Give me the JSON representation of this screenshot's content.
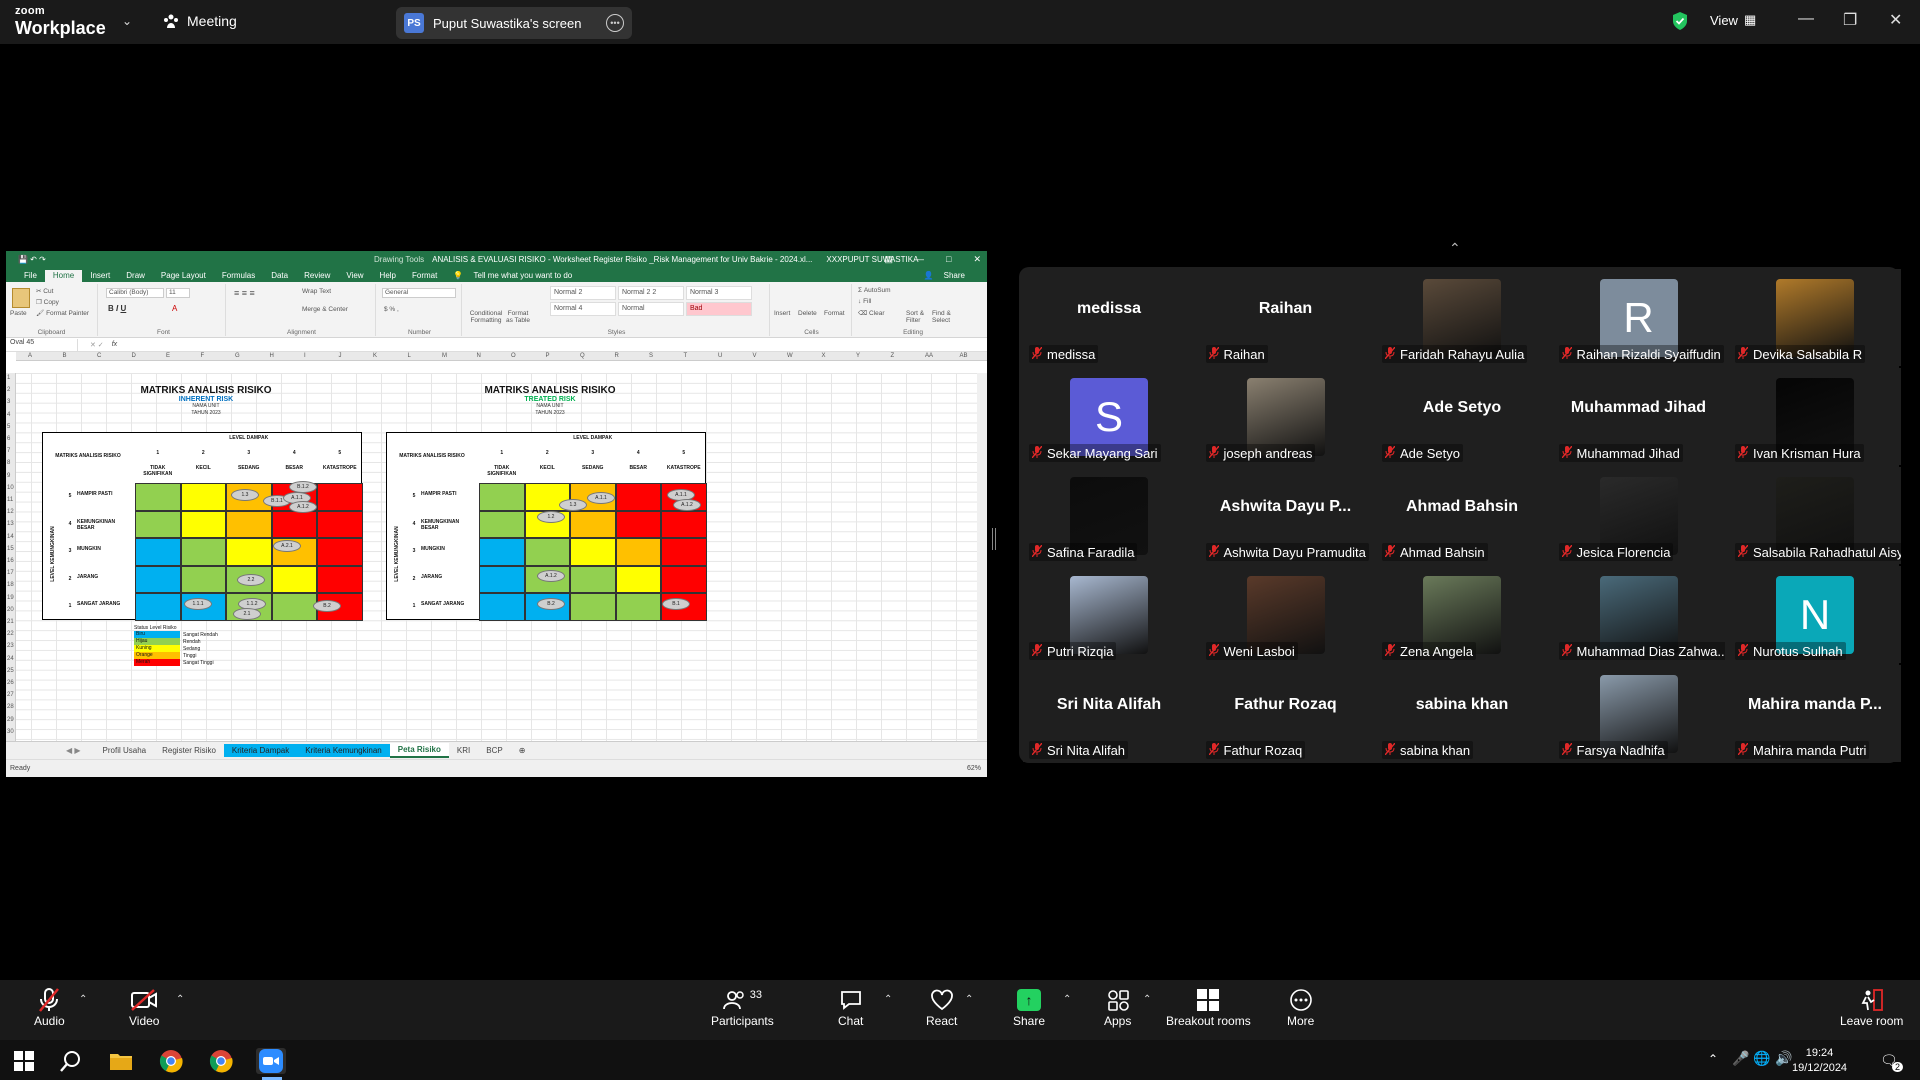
{
  "topbar": {
    "logo_line1": "zoom",
    "logo_line2": "Workplace",
    "meeting_label": "Meeting",
    "screen_badge": "PS",
    "screen_label": "Puput Suwastika's screen",
    "view_label": "View"
  },
  "excel": {
    "title": "ANALISIS & EVALUASI RISIKO - Worksheet Register Risiko _Risk Management for Univ Bakrie - 2024.xl...",
    "user": "XXXPUPUT SUWASTIKA",
    "drawing_tools": "Drawing Tools",
    "tabs": [
      "File",
      "Home",
      "Insert",
      "Draw",
      "Page Layout",
      "Formulas",
      "Data",
      "Review",
      "View",
      "Help",
      "Format"
    ],
    "tell_me": "Tell me what you want to do",
    "share": "Share",
    "ribbon": {
      "paste": "Paste",
      "cut": "Cut",
      "copy": "Copy",
      "format_painter": "Format Painter",
      "clipboard": "Clipboard",
      "font_name": "Calibri (Body)",
      "font_size": "11",
      "font": "Font",
      "wrap_text": "Wrap Text",
      "merge": "Merge & Center",
      "alignment": "Alignment",
      "number_format": "General",
      "number": "Number",
      "cond_format": "Conditional Formatting",
      "format_table": "Format as Table",
      "styles": [
        "Normal 2",
        "Normal 2 2",
        "Normal 3",
        "Normal 4",
        "Normal",
        "Bad"
      ],
      "styles_label": "Styles",
      "insert": "Insert",
      "delete": "Delete",
      "format": "Format",
      "cells": "Cells",
      "autosum": "AutoSum",
      "fill": "Fill",
      "clear": "Clear",
      "sort": "Sort & Filter",
      "find": "Find & Select",
      "editing": "Editing"
    },
    "name_box": "Oval 45",
    "fx": "fx",
    "columns": [
      "A",
      "B",
      "C",
      "D",
      "E",
      "F",
      "G",
      "H",
      "I",
      "J",
      "K",
      "L",
      "M",
      "N",
      "O",
      "P",
      "Q",
      "R",
      "S",
      "T",
      "U",
      "V",
      "W",
      "X",
      "Y",
      "Z",
      "AA",
      "AB"
    ],
    "rows": [
      "1",
      "2",
      "3",
      "4",
      "5",
      "6",
      "7",
      "8",
      "9",
      "10",
      "11",
      "12",
      "13",
      "14",
      "15",
      "16",
      "17",
      "18",
      "19",
      "20",
      "21",
      "22",
      "23",
      "24",
      "25",
      "26",
      "27",
      "28",
      "29",
      "30"
    ],
    "matrix_left": {
      "title": "MATRIKS ANALISIS RISIKO",
      "subtitle": "INHERENT RISK",
      "unit": "NAMA UNIT",
      "year": "TAHUN 2023",
      "sub_color": "#0070c0"
    },
    "matrix_right": {
      "title": "MATRIKS ANALISIS RISIKO",
      "subtitle": "TREATED RISK",
      "unit": "NAMA UNIT",
      "year": "TAHUN 2023",
      "sub_color": "#00b050"
    },
    "matrix_labels": {
      "corner": "MATRIKS ANALISIS RISIKO",
      "level_dampak": "LEVEL DAMPAK",
      "level_kemungkinan": "LEVEL KEMUNGKINAN",
      "impact_numbers": [
        "1",
        "2",
        "3",
        "4",
        "5"
      ],
      "impact_names": [
        "TIDAK SIGNIFIKAN",
        "KECIL",
        "SEDANG",
        "BESAR",
        "KATASTROPE"
      ],
      "likelihood_numbers": [
        "5",
        "4",
        "3",
        "2",
        "1"
      ],
      "likelihood_names": [
        "HAMPIR PASTI",
        "KEMUNGKINAN BESAR",
        "MUNGKIN",
        "JARANG",
        "SANGAT JARANG"
      ]
    },
    "heat_colors": [
      [
        "#92d050",
        "#ffff00",
        "#ffc000",
        "#ff0000",
        "#ff0000"
      ],
      [
        "#92d050",
        "#ffff00",
        "#ffc000",
        "#ff0000",
        "#ff0000"
      ],
      [
        "#00b0f0",
        "#92d050",
        "#ffff00",
        "#ffc000",
        "#ff0000"
      ],
      [
        "#00b0f0",
        "#92d050",
        "#92d050",
        "#ffff00",
        "#ff0000"
      ],
      [
        "#00b0f0",
        "#00b0f0",
        "#92d050",
        "#92d050",
        "#ff0000"
      ]
    ],
    "ovals_left": [
      "1.3",
      "B.1.1",
      "A.1.1",
      "B.1.2",
      "A.1.2",
      "A.2.1",
      "2.2",
      "1.1.1",
      "1.1.2",
      "2.1",
      "B.2"
    ],
    "ovals_right": [
      "A.1.1",
      "1.3",
      "A.1.1",
      "A.1.2",
      "1.2",
      "A.1.2",
      "B.2",
      "B.1"
    ],
    "legend": {
      "title": "Status Level Risiko",
      "items": [
        {
          "color": "Biru",
          "level": "Sangat Rendah",
          "hex": "#00b0f0"
        },
        {
          "color": "Hijau",
          "level": "Rendah",
          "hex": "#92d050"
        },
        {
          "color": "Kuning",
          "level": "Sedang",
          "hex": "#ffff00"
        },
        {
          "color": "Orange",
          "level": "Tinggi",
          "hex": "#ffc000"
        },
        {
          "color": "Merah",
          "level": "Sangat Tinggi",
          "hex": "#ff0000"
        }
      ]
    },
    "sheets": [
      "Profil Usaha",
      "Register Risiko",
      "Kriteria Dampak",
      "Kriteria Kemungkinan",
      "Peta Risiko",
      "KRI",
      "BCP"
    ],
    "status": "Ready",
    "zoom": "62%"
  },
  "participants": [
    {
      "name": "medissa",
      "display": "medissa",
      "type": "name"
    },
    {
      "name": "Raihan",
      "display": "Raihan",
      "type": "name"
    },
    {
      "name": "Faridah Rahayu Aulia",
      "type": "photo",
      "color": "#5a4a3a"
    },
    {
      "name": "Raihan Rizaldi Syaiffudin",
      "type": "avatar",
      "letter": "R",
      "color": "#7d8c9c"
    },
    {
      "name": "Devika Salsabila R",
      "type": "photo",
      "color": "#b07a2a"
    },
    {
      "name": "Sekar Mayang Sari",
      "type": "avatar",
      "letter": "S",
      "color": "#5b5bd6"
    },
    {
      "name": "joseph andreas",
      "type": "photo",
      "color": "#8a8070"
    },
    {
      "name": "Ade Setyo",
      "display": "Ade Setyo",
      "type": "name"
    },
    {
      "name": "Muhammad Jihad",
      "display": "Muhammad Jihad",
      "type": "name"
    },
    {
      "name": "Ivan Krisman Hura",
      "type": "photo",
      "color": "#050505"
    },
    {
      "name": "Safina Faradila",
      "type": "photo",
      "color": "#0c0c0c"
    },
    {
      "name": "Ashwita Dayu Pramudita",
      "display": "Ashwita Dayu P...",
      "type": "name"
    },
    {
      "name": "Ahmad Bahsin",
      "display": "Ahmad Bahsin",
      "type": "name"
    },
    {
      "name": "Jesica Florencia",
      "type": "photo",
      "color": "#2a2a2a"
    },
    {
      "name": "Salsabila Rahadhatul Aisy",
      "type": "photo",
      "color": "#1e1e1a"
    },
    {
      "name": "Putri Rizqia",
      "type": "photo",
      "color": "#a8b8d0"
    },
    {
      "name": "Weni Lasboi",
      "type": "photo",
      "color": "#5a3a2a"
    },
    {
      "name": "Zena Angela",
      "type": "photo",
      "color": "#6a7a5a"
    },
    {
      "name": "Muhammad Dias Zahwa...",
      "type": "photo",
      "color": "#4a6a7a"
    },
    {
      "name": "Nurotus Sulhah",
      "type": "avatar",
      "letter": "N",
      "color": "#0aa8b8"
    },
    {
      "name": "Sri Nita Alifah",
      "display": "Sri Nita Alifah",
      "type": "name"
    },
    {
      "name": "Fathur Rozaq",
      "display": "Fathur Rozaq",
      "type": "name"
    },
    {
      "name": "sabina khan",
      "display": "sabina khan",
      "type": "name"
    },
    {
      "name": "Farsya Nadhifa",
      "type": "photo",
      "color": "#8a9aaa"
    },
    {
      "name": "Mahira manda Putri",
      "display": "Mahira manda P...",
      "type": "name"
    }
  ],
  "toolbar": {
    "audio": "Audio",
    "video": "Video",
    "participants": "Participants",
    "participants_count": "33",
    "chat": "Chat",
    "react": "React",
    "share": "Share",
    "apps": "Apps",
    "breakout": "Breakout rooms",
    "more": "More",
    "leave": "Leave room"
  },
  "taskbar": {
    "time": "19:24",
    "date": "19/12/2024",
    "notif_count": "2"
  }
}
